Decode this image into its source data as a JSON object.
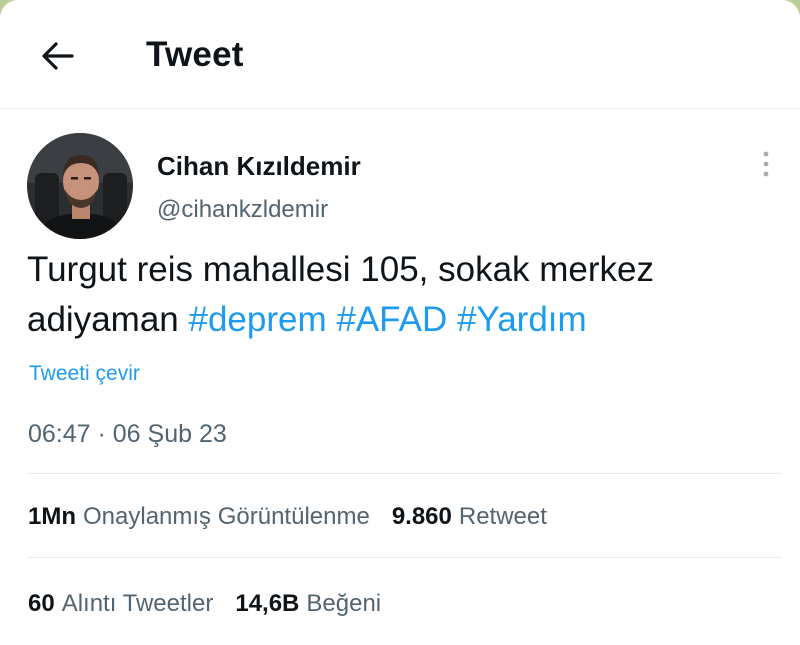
{
  "header": {
    "title": "Tweet",
    "back_icon": "arrow-left-icon"
  },
  "author": {
    "display_name": "Cihan Kızıldemir",
    "handle": "@cihankzldemir"
  },
  "tweet": {
    "text_prefix": "Turgut reis mahallesi 105, sokak merkez adiyaman",
    "hashtags": [
      "#deprem",
      "#AFAD",
      "#Yardım"
    ],
    "translate_label": "Tweeti çevir",
    "timestamp": "06:47 · 06 Şub 23"
  },
  "stats_row_1": [
    {
      "value": "1Mn",
      "label": "Onaylanmış Görüntülenme"
    },
    {
      "value": "9.860",
      "label": "Retweet"
    }
  ],
  "stats_row_2": [
    {
      "value": "60",
      "label": "Alıntı Tweetler"
    },
    {
      "value": "14,6B",
      "label": "Beğeni"
    }
  ],
  "colors": {
    "accent": "#1d9bf0",
    "text_primary": "#0f1419",
    "text_secondary": "#536471"
  }
}
